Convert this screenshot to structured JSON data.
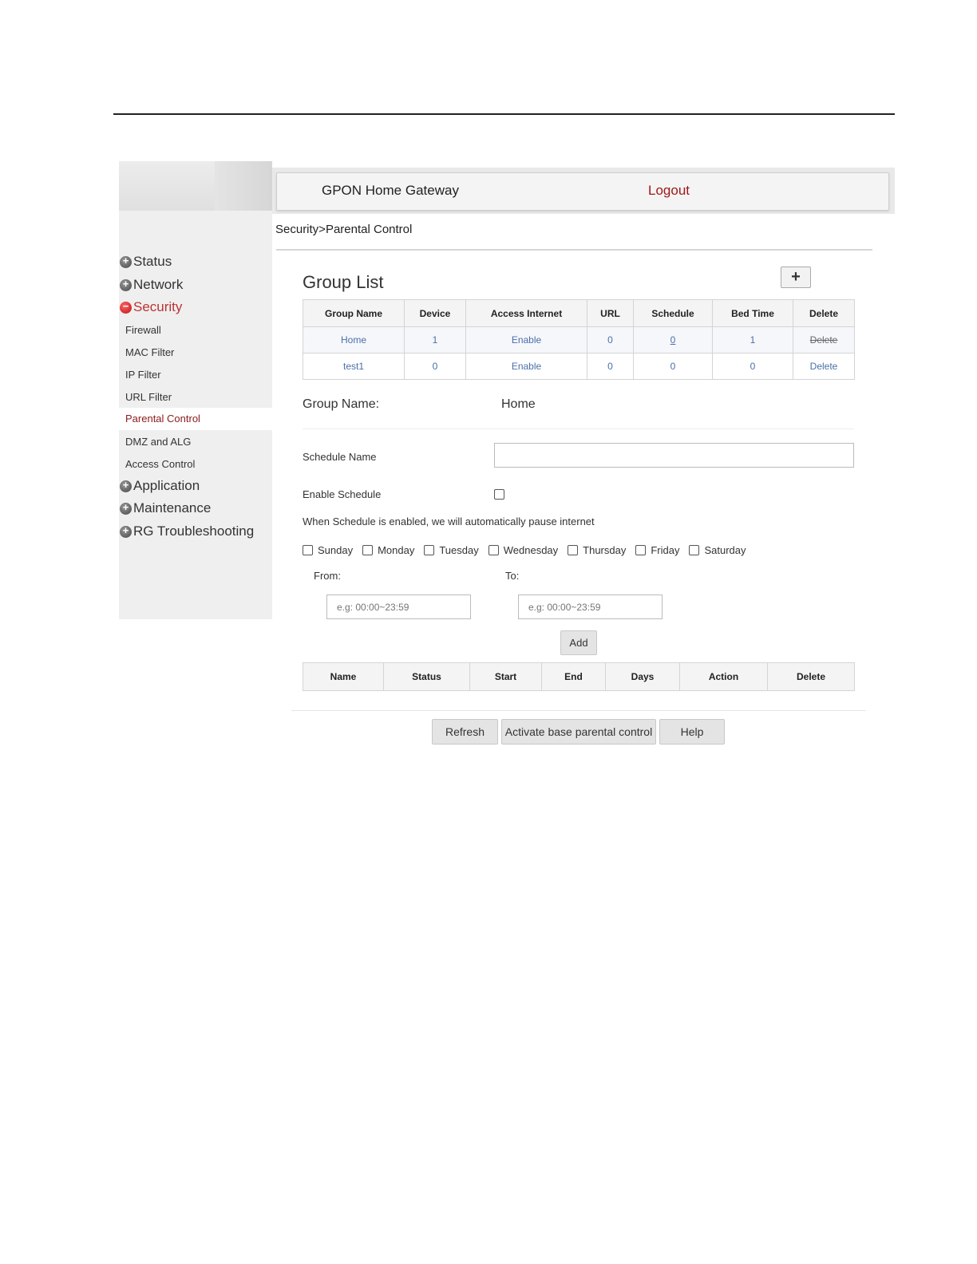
{
  "header": {
    "app_title": "GPON Home Gateway",
    "logout_label": "Logout"
  },
  "breadcrumb": "Security>Parental Control",
  "sidebar": {
    "main_items": [
      {
        "label": "Status",
        "icon": "expand-icon"
      },
      {
        "label": "Network",
        "icon": "expand-icon"
      },
      {
        "label": "Security",
        "icon": "collapse-icon"
      },
      {
        "label": "Application",
        "icon": "expand-icon"
      },
      {
        "label": "Maintenance",
        "icon": "expand-icon"
      },
      {
        "label": "RG Troubleshooting",
        "icon": "expand-icon"
      }
    ],
    "security_sub_items": [
      "Firewall",
      "MAC Filter",
      "IP Filter",
      "URL Filter",
      "Parental Control",
      "DMZ and ALG",
      "Access Control"
    ],
    "active_sub_item": "Parental Control"
  },
  "group_list": {
    "title": "Group List",
    "add_icon": "plus-icon",
    "columns": [
      "Group Name",
      "Device",
      "Access Internet",
      "URL",
      "Schedule",
      "Bed Time",
      "Delete"
    ],
    "rows": [
      [
        "Home",
        "1",
        "Enable",
        "0",
        "0",
        "1",
        "Delete"
      ],
      [
        "test1",
        "0",
        "Enable",
        "0",
        "0",
        "0",
        "Delete"
      ]
    ]
  },
  "group_detail": {
    "name_label": "Group Name:",
    "name_value": "Home",
    "schedule_name_label": "Schedule Name",
    "schedule_name_value": "",
    "enable_schedule_label": "Enable Schedule",
    "enable_schedule_checked": false,
    "note": "When Schedule is enabled, we will automatically pause internet",
    "days": [
      "Sunday",
      "Monday",
      "Tuesday",
      "Wednesday",
      "Thursday",
      "Friday",
      "Saturday"
    ],
    "from_label": "From:",
    "to_label": "To:",
    "from_placeholder": "e.g: 00:00~23:59",
    "to_placeholder": "e.g: 00:00~23:59",
    "add_label": "Add"
  },
  "schedule_table": {
    "columns": [
      "Name",
      "Status",
      "Start",
      "End",
      "Days",
      "Action",
      "Delete"
    ]
  },
  "footer_buttons": {
    "refresh": "Refresh",
    "activate": "Activate base parental control",
    "help": "Help"
  },
  "colors": {
    "accent_red": "#a01818",
    "link_blue": "#4a6fa8"
  }
}
